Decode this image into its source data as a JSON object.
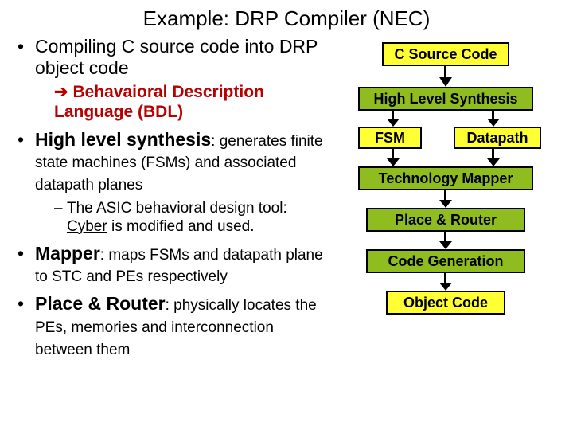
{
  "title": "Example: DRP Compiler (NEC)",
  "bullets": {
    "compile": "Compiling C source code into DRP object code",
    "bdl_arrow": "➔",
    "bdl": " Behavaioral Description Language (BDL)",
    "hls_head": "High level synthesis",
    "hls_body": ": generates finite state machines (FSMs) and associated datapath planes",
    "asic_prefix": "The ASIC behavioral design tool: ",
    "asic_tool": "Cyber",
    "asic_suffix": " is modified and used.",
    "mapper_head": "Mapper",
    "mapper_body": ": maps FSMs and datapath plane to STC and PEs respectively",
    "pr_head": "Place & Router",
    "pr_body": ": physically locates the PEs, memories and interconnection between  them"
  },
  "flow": {
    "csource": "C Source Code",
    "hls": "High Level Synthesis",
    "fsm": "FSM",
    "datapath": "Datapath",
    "techmap": "Technology Mapper",
    "placeroute": "Place & Router",
    "codegen": "Code Generation",
    "objcode": "Object Code"
  }
}
